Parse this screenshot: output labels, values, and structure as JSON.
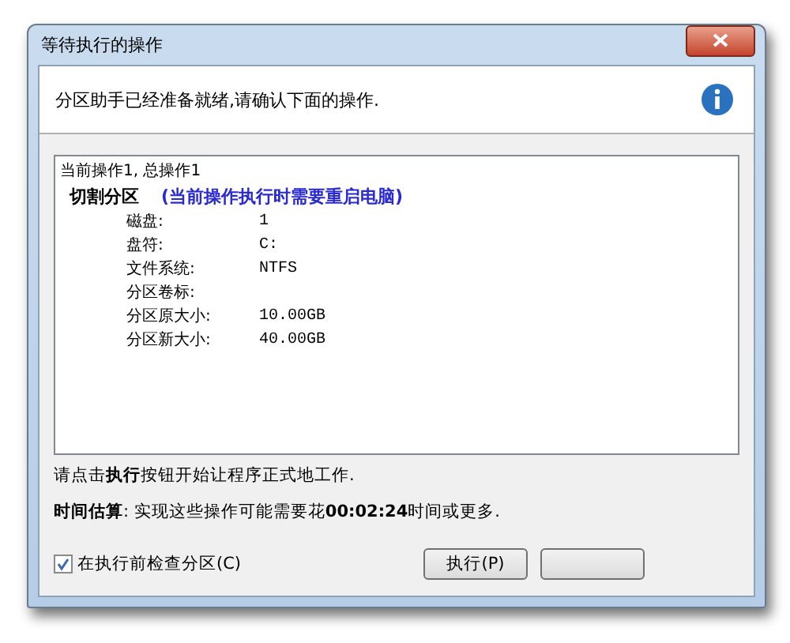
{
  "window": {
    "title": "等待执行的操作"
  },
  "header": {
    "message": "分区助手已经准备就绪,请确认下面的操作."
  },
  "operations": {
    "summary": "当前操作1, 总操作1",
    "title": "切割分区",
    "note": "(当前操作执行时需要重启电脑)",
    "details": [
      {
        "label": "磁盘:",
        "value": "1"
      },
      {
        "label": "盘符:",
        "value": "C:"
      },
      {
        "label": "文件系统:",
        "value": "NTFS"
      },
      {
        "label": "分区卷标:"
      },
      {
        "label": "分区原大小:",
        "value": "10.00GB"
      },
      {
        "label": "分区新大小:",
        "value": "40.00GB"
      }
    ]
  },
  "instruction": "请点击**执行**按钮开始让程序正式地工作.",
  "estimate": "**时间估算**: 实现这些操作可能需要花**00:02:24**时间或更多.",
  "check_option": {
    "label": "在执行前检查分区(C)",
    "checked": true
  },
  "buttons": [
    "执行(P)"
  ]
}
